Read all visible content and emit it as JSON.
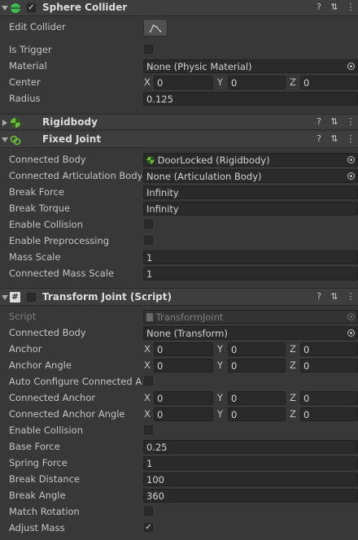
{
  "sphere_collider": {
    "title": "Sphere Collider",
    "enabled": true,
    "edit_collider_label": "Edit Collider",
    "is_trigger_label": "Is Trigger",
    "is_trigger": false,
    "material_label": "Material",
    "material_value": "None (Physic Material)",
    "center_label": "Center",
    "center": {
      "x": "0",
      "y": "0",
      "z": "0"
    },
    "radius_label": "Radius",
    "radius_value": "0.125"
  },
  "rigidbody": {
    "title": "Rigidbody"
  },
  "fixed_joint": {
    "title": "Fixed Joint",
    "connected_body_label": "Connected Body",
    "connected_body_value": "DoorLocked (Rigidbody)",
    "connected_articulation_label": "Connected Articulation Body",
    "connected_articulation_value": "None (Articulation Body)",
    "break_force_label": "Break Force",
    "break_force_value": "Infinity",
    "break_torque_label": "Break Torque",
    "break_torque_value": "Infinity",
    "enable_collision_label": "Enable Collision",
    "enable_collision": false,
    "enable_preprocessing_label": "Enable Preprocessing",
    "enable_preprocessing": false,
    "mass_scale_label": "Mass Scale",
    "mass_scale_value": "1",
    "connected_mass_scale_label": "Connected Mass Scale",
    "connected_mass_scale_value": "1"
  },
  "transform_joint": {
    "title": "Transform Joint (Script)",
    "enabled": false,
    "script_label": "Script",
    "script_value": "TransformJoint",
    "connected_body_label": "Connected Body",
    "connected_body_value": "None (Transform)",
    "anchor_label": "Anchor",
    "anchor": {
      "x": "0",
      "y": "0",
      "z": "0"
    },
    "anchor_angle_label": "Anchor Angle",
    "anchor_angle": {
      "x": "0",
      "y": "0",
      "z": "0"
    },
    "auto_configure_label": "Auto Configure Connected Anchor",
    "auto_configure": false,
    "connected_anchor_label": "Connected Anchor",
    "connected_anchor": {
      "x": "0",
      "y": "0",
      "z": "0"
    },
    "connected_anchor_angle_label": "Connected Anchor Angle",
    "connected_anchor_angle": {
      "x": "0",
      "y": "0",
      "z": "0"
    },
    "enable_collision_label": "Enable Collision",
    "enable_collision": false,
    "base_force_label": "Base Force",
    "base_force_value": "0.25",
    "spring_force_label": "Spring Force",
    "spring_force_value": "1",
    "break_distance_label": "Break Distance",
    "break_distance_value": "100",
    "break_angle_label": "Break Angle",
    "break_angle_value": "360",
    "match_rotation_label": "Match Rotation",
    "match_rotation": false,
    "adjust_mass_label": "Adjust Mass",
    "adjust_mass": true
  },
  "axes": {
    "x": "X",
    "y": "Y",
    "z": "Z"
  },
  "glyphs": {
    "check": "✓",
    "help": "?",
    "preset": "⇅",
    "menu": "⋮",
    "script": "#"
  },
  "icons": [
    "sphere-collider-icon",
    "rigidbody-icon",
    "fixed-joint-icon",
    "script-icon",
    "help-icon",
    "preset-icon",
    "context-menu-icon",
    "object-picker-icon",
    "edit-collider-icon"
  ],
  "colors": {
    "background": "#383838",
    "header": "#3e3e3e",
    "field": "#2a2a2a",
    "collider_green": "#3fb950",
    "rigidbody_green": "#6bbf3a"
  }
}
